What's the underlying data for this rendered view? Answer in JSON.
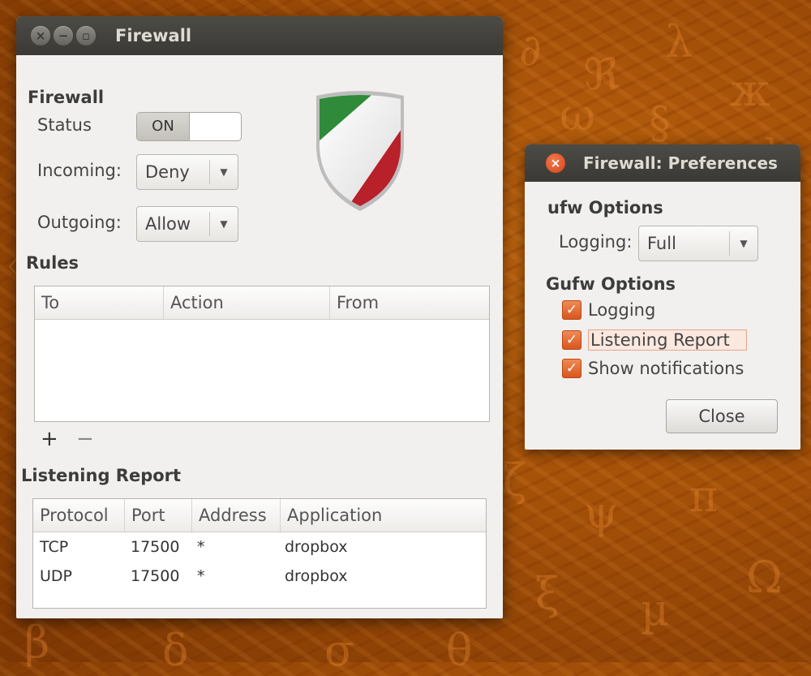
{
  "main_window": {
    "title": "Firewall",
    "section_firewall": "Firewall",
    "status_label": "Status",
    "status_value": "ON",
    "incoming_label": "Incoming:",
    "incoming_value": "Deny",
    "outgoing_label": "Outgoing:",
    "outgoing_value": "Allow",
    "rules_heading": "Rules",
    "rules_columns": [
      "To",
      "Action",
      "From"
    ],
    "add_rule": "+",
    "remove_rule": "−",
    "listening_heading": "Listening Report",
    "listening_columns": [
      "Protocol",
      "Port",
      "Address",
      "Application"
    ],
    "listening_rows": [
      {
        "protocol": "TCP",
        "port": "17500",
        "address": "*",
        "application": "dropbox"
      },
      {
        "protocol": "UDP",
        "port": "17500",
        "address": "*",
        "application": "dropbox"
      }
    ]
  },
  "pref_window": {
    "title": "Firewall: Preferences",
    "ufw_heading": "ufw Options",
    "logging_label": "Logging:",
    "logging_value": "Full",
    "gufw_heading": "Gufw Options",
    "options": [
      {
        "label": "Logging",
        "checked": true
      },
      {
        "label": "Listening Report",
        "checked": true
      },
      {
        "label": "Show notifications",
        "checked": true
      }
    ],
    "close_label": "Close"
  },
  "colors": {
    "accent": "#dd5b21",
    "titlebar": "#3f3e3a",
    "window_bg": "#f1f0ee",
    "shield_green": "#2f8a3a",
    "shield_red": "#b8202a"
  },
  "icons": {
    "window_close": "close-icon",
    "window_minimize": "minimize-icon",
    "window_maximize": "maximize-icon",
    "combo_arrow": "chevron-down-icon",
    "logo": "shield-icon"
  }
}
